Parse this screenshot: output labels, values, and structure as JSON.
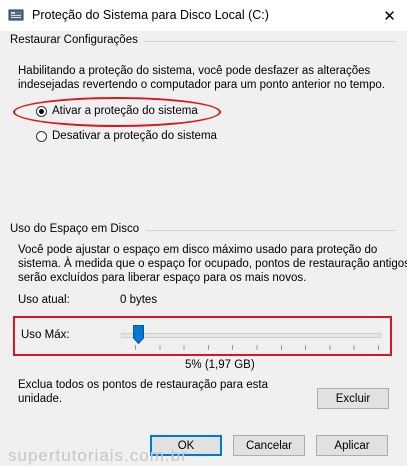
{
  "window": {
    "title": "Proteção do Sistema para Disco Local (C:)",
    "close_glyph": "✕"
  },
  "restore": {
    "group_title": "Restaurar Configurações",
    "description_line1": "Habilitando a proteção do sistema, você pode desfazer as alterações",
    "description_line2": "indesejadas revertendo o computador para um ponto anterior no tempo.",
    "options": [
      {
        "label": "Ativar a proteção do sistema",
        "selected": true
      },
      {
        "label": "Desativar a proteção do sistema",
        "selected": false
      }
    ]
  },
  "disk_usage": {
    "group_title": "Uso do Espaço em Disco",
    "description_line1": "Você pode ajustar o espaço em disco máximo usado para proteção do",
    "description_line2": "sistema. À medida que o espaço for ocupado, pontos de restauração antigos",
    "description_line3": "serão excluídos para liberar espaço para os mais novos.",
    "current_label": "Uso atual:",
    "current_value": "0 bytes",
    "max_label": "Uso Máx:",
    "max_percent": 5,
    "max_value_text": "5% (1,97 GB)"
  },
  "delete": {
    "text_line1": "Exclua todos os pontos de restauração para esta",
    "text_line2": "unidade.",
    "button_label": "Excluir"
  },
  "footer": {
    "ok_label": "OK",
    "cancel_label": "Cancelar",
    "apply_label": "Aplicar"
  },
  "watermark": "supertutoriais.com.br",
  "colors": {
    "highlight": "#d7191d",
    "slider_thumb": "#0078d7"
  }
}
